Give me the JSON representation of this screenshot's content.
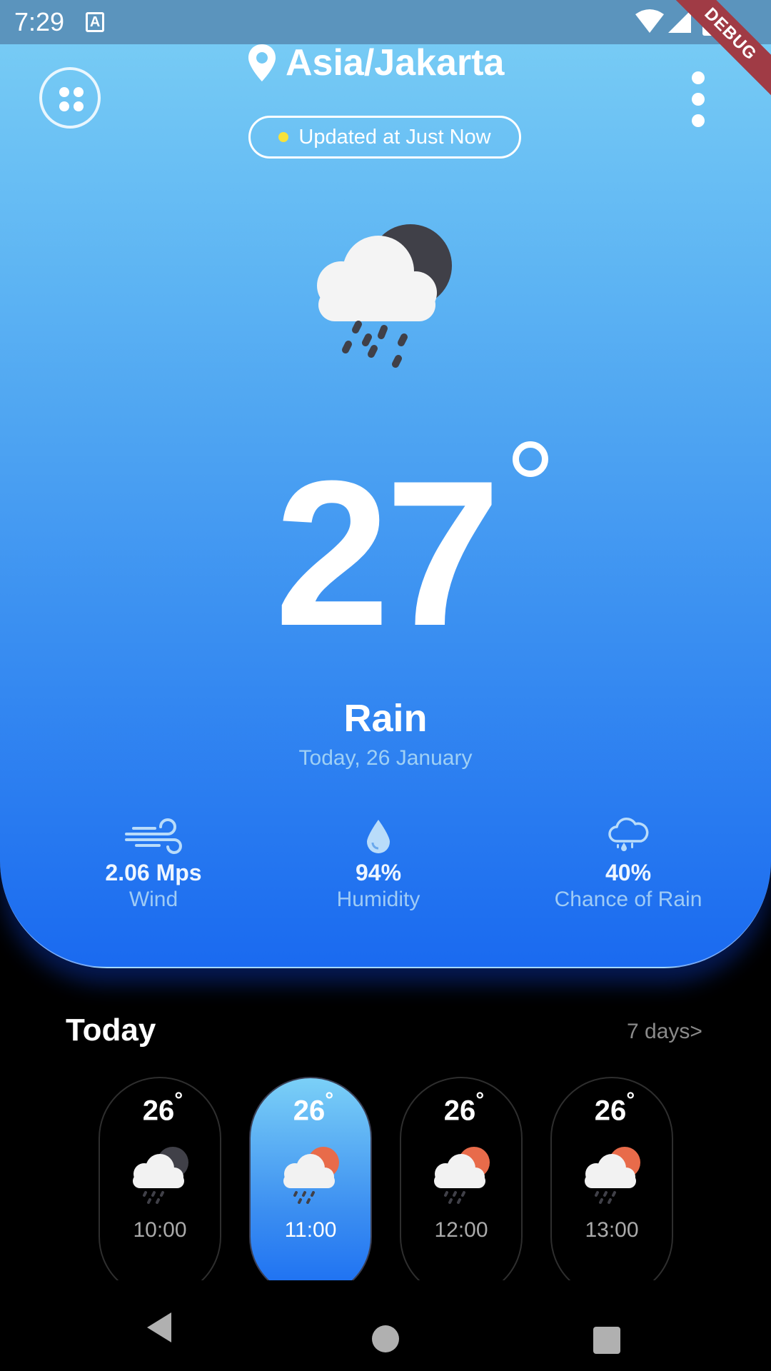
{
  "status_bar": {
    "time": "7:29",
    "keyboard_icon_letter": "A",
    "icons": [
      "wifi-icon",
      "signal-icon",
      "battery-icon"
    ]
  },
  "debug_banner": "DEBUG",
  "header": {
    "location": "Asia/Jakarta",
    "updated": "Updated at Just Now"
  },
  "current": {
    "temperature": "27",
    "condition": "Rain",
    "date": "Today, 26 January",
    "icon": "cloud-rain-night-icon"
  },
  "stats": [
    {
      "value": "2.06 Mps",
      "label": "Wind",
      "icon": "wind-icon"
    },
    {
      "value": "94%",
      "label": "Humidity",
      "icon": "drop-icon"
    },
    {
      "value": "40%",
      "label": "Chance of Rain",
      "icon": "cloud-drizzle-icon"
    }
  ],
  "today": {
    "title": "Today",
    "more_link": "7 days>",
    "hours": [
      {
        "temp": "26",
        "time": "10:00",
        "icon": "cloud-rain-moon-icon",
        "active": false
      },
      {
        "temp": "26",
        "time": "11:00",
        "icon": "cloud-rain-sun-icon",
        "active": true
      },
      {
        "temp": "26",
        "time": "12:00",
        "icon": "cloud-rain-sun-icon",
        "active": false
      },
      {
        "temp": "26",
        "time": "13:00",
        "icon": "cloud-rain-sun-icon",
        "active": false
      }
    ]
  },
  "colors": {
    "accent_blue": "#3a8ff1",
    "sun": "#e86b4a",
    "moon": "#3f3f46",
    "update_dot": "#f7e23a"
  }
}
